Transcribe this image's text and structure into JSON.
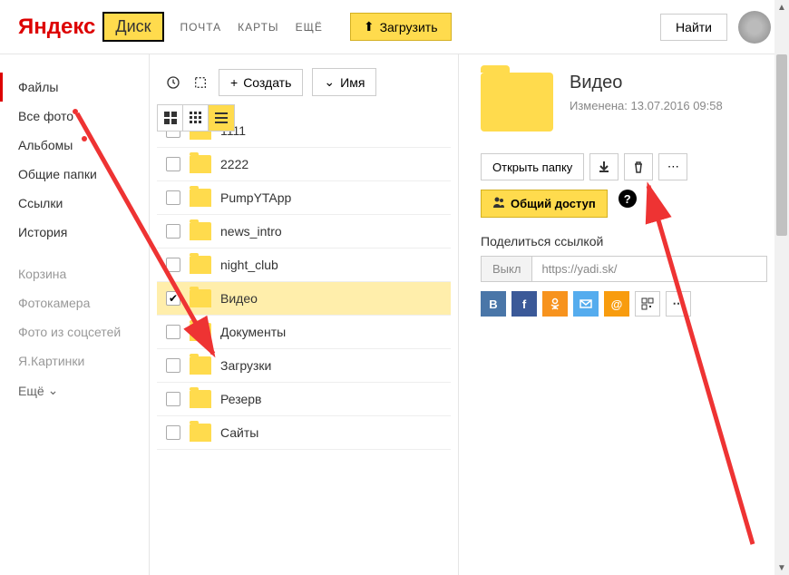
{
  "header": {
    "brand": "Яндекс",
    "product": "Диск",
    "nav": [
      "ПОЧТА",
      "КАРТЫ",
      "ЕЩЁ"
    ],
    "upload": "Загрузить",
    "search": "Найти"
  },
  "sidebar": {
    "main": [
      {
        "label": "Файлы",
        "active": true
      },
      {
        "label": "Все фото"
      },
      {
        "label": "Альбомы"
      },
      {
        "label": "Общие папки"
      },
      {
        "label": "Ссылки"
      },
      {
        "label": "История"
      }
    ],
    "secondary": [
      {
        "label": "Корзина"
      },
      {
        "label": "Фотокамера"
      },
      {
        "label": "Фото из соцсетей"
      },
      {
        "label": "Я.Картинки"
      }
    ],
    "more": "Ещё"
  },
  "toolbar": {
    "create": "Создать",
    "sort": "Имя"
  },
  "files": [
    {
      "name": "1111",
      "checked": false
    },
    {
      "name": "2222",
      "checked": false
    },
    {
      "name": "PumpYTApp",
      "checked": false
    },
    {
      "name": "news_intro",
      "checked": false
    },
    {
      "name": "night_club",
      "checked": false
    },
    {
      "name": "Видео",
      "checked": true,
      "selected": true
    },
    {
      "name": "Документы",
      "checked": false
    },
    {
      "name": "Загрузки",
      "checked": false
    },
    {
      "name": "Резерв",
      "checked": false
    },
    {
      "name": "Сайты",
      "checked": false
    }
  ],
  "details": {
    "title": "Видео",
    "modified_label": "Изменена:",
    "modified_value": "13.07.2016 09:58",
    "open": "Открыть папку",
    "share": "Общий доступ",
    "share_link_label": "Поделиться ссылкой",
    "toggle": "Выкл",
    "link": "https://yadi.sk/"
  }
}
